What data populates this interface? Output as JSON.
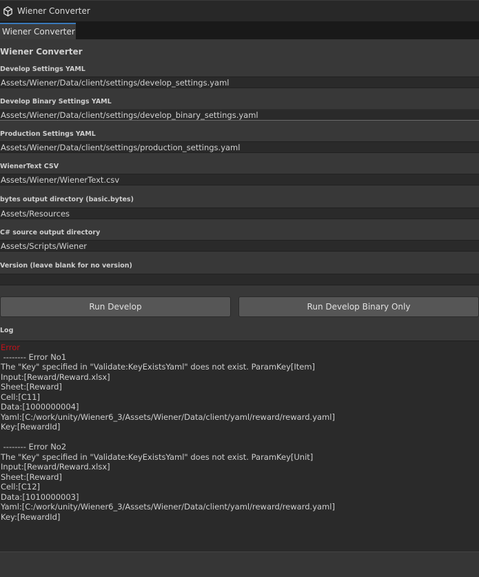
{
  "window": {
    "title": "Wiener Converter",
    "icon": "unity-cube-icon"
  },
  "tab": {
    "label": "Wiener Converter"
  },
  "main": {
    "title": "Wiener Converter"
  },
  "fields": [
    {
      "label": "Develop Settings YAML",
      "value": "Assets/Wiener/Data/client/settings/develop_settings.yaml"
    },
    {
      "label": "Develop Binary Settings YAML",
      "value": "Assets/Wiener/Data/client/settings/develop_binary_settings.yaml"
    },
    {
      "label": "Production Settings YAML",
      "value": "Assets/Wiener/Data/client/settings/production_settings.yaml"
    },
    {
      "label": "WienerText CSV",
      "value": "Assets/Wiener/WienerText.csv"
    },
    {
      "label": "bytes output directory (basic.bytes)",
      "value": "Assets/Resources"
    },
    {
      "label": "C# source output directory",
      "value": "Assets/Scripts/Wiener"
    },
    {
      "label": "Version (leave blank for no version)",
      "value": ""
    }
  ],
  "buttons": {
    "run_develop": "Run Develop",
    "run_develop_binary": "Run Develop Binary Only"
  },
  "log": {
    "label": "Log",
    "lines": [
      "Error",
      " -------- Error No1",
      "The \"Key\" specified in \"Validate:KeyExistsYaml\" does not exist. ParamKey[Item]",
      "Input:[Reward/Reward.xlsx]",
      "Sheet:[Reward]",
      "Cell:[C11]",
      "Data:[1000000004]",
      "Yaml:[C:/work/unity/Wiener6_3/Assets/Wiener/Data/client/yaml/reward/reward.yaml]",
      "Key:[RewardId]",
      "",
      " -------- Error No2",
      "The \"Key\" specified in \"Validate:KeyExistsYaml\" does not exist. ParamKey[Unit]",
      "Input:[Reward/Reward.xlsx]",
      "Sheet:[Reward]",
      "Cell:[C12]",
      "Data:[1010000003]",
      "Yaml:[C:/work/unity/Wiener6_3/Assets/Wiener/Data/client/yaml/reward/reward.yaml]",
      "Key:[RewardId]"
    ]
  },
  "colors": {
    "error": "#c1121b",
    "tab_accent": "#3a79bb"
  }
}
